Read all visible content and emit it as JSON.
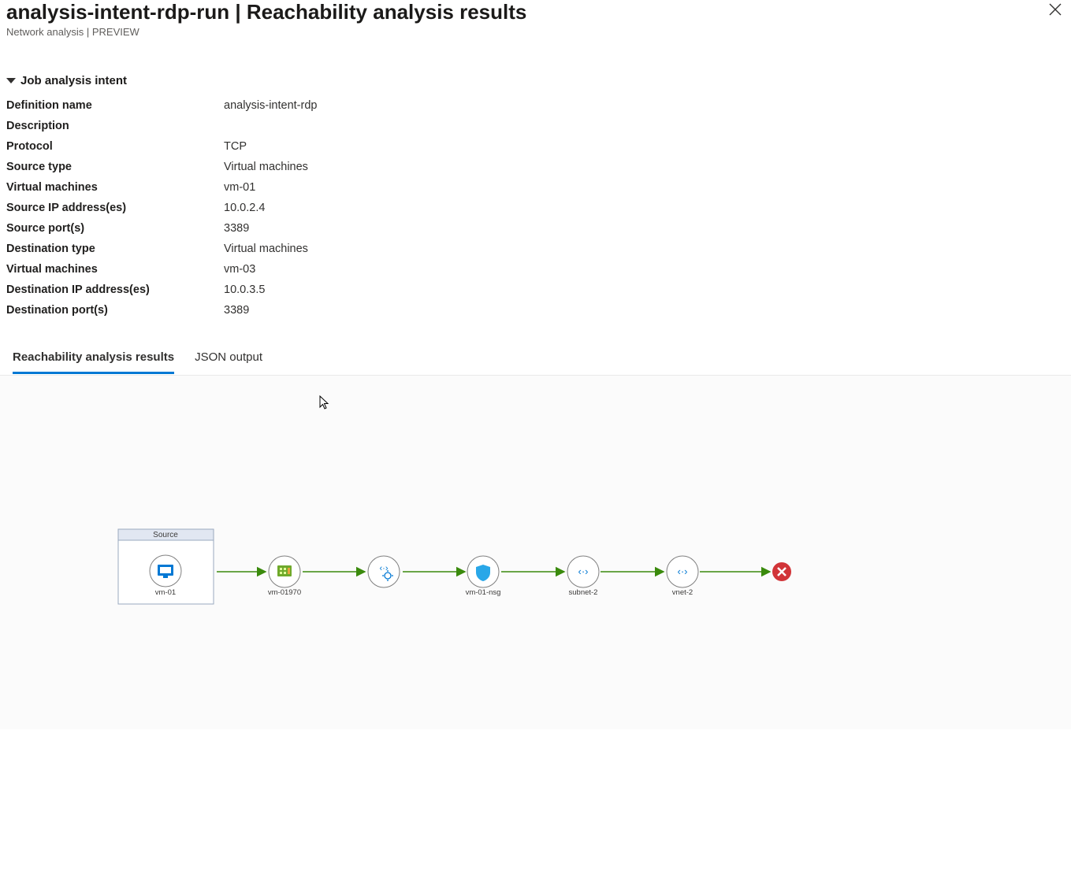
{
  "header": {
    "title": "analysis-intent-rdp-run | Reachability analysis results",
    "subtitle": "Network analysis | PREVIEW"
  },
  "sectionTitle": "Job analysis intent",
  "properties": [
    {
      "label": "Definition name",
      "value": "analysis-intent-rdp"
    },
    {
      "label": "Description",
      "value": ""
    },
    {
      "label": "Protocol",
      "value": "TCP"
    },
    {
      "label": "Source type",
      "value": "Virtual machines"
    },
    {
      "label": "Virtual machines",
      "value": "vm-01"
    },
    {
      "label": "Source IP address(es)",
      "value": "10.0.2.4"
    },
    {
      "label": "Source port(s)",
      "value": "3389"
    },
    {
      "label": "Destination type",
      "value": "Virtual machines"
    },
    {
      "label": "Virtual machines",
      "value": "vm-03"
    },
    {
      "label": "Destination IP address(es)",
      "value": "10.0.3.5"
    },
    {
      "label": "Destination port(s)",
      "value": "3389"
    }
  ],
  "tabs": {
    "active": "Reachability analysis results",
    "inactive": "JSON output"
  },
  "diagram": {
    "sourceBoxLabel": "Source",
    "nodes": [
      {
        "label": "vm-01",
        "icon": "vm"
      },
      {
        "label": "vm-01970",
        "icon": "nic"
      },
      {
        "label": "",
        "icon": "gear"
      },
      {
        "label": "vm-01-nsg",
        "icon": "shield"
      },
      {
        "label": "subnet-2",
        "icon": "net"
      },
      {
        "label": "vnet-2",
        "icon": "net"
      }
    ]
  }
}
